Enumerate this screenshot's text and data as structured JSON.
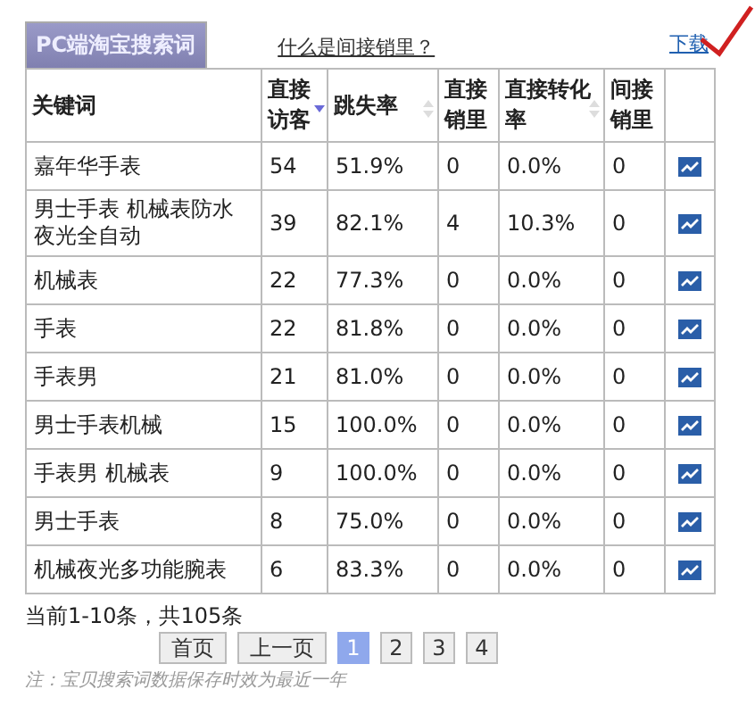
{
  "tab": {
    "label": "PC端淘宝搜索词",
    "selected": true
  },
  "help_link": "什么是间接销里？",
  "download_link": "下载",
  "table": {
    "columns": [
      {
        "label": "关键词"
      },
      {
        "label": "直接访客",
        "sorted": true
      },
      {
        "label": "跳失率",
        "sorted": false
      },
      {
        "label": "直接销里"
      },
      {
        "label": "直接转化率",
        "sorted": false
      },
      {
        "label": "间接销里"
      }
    ],
    "rows": [
      [
        "嘉年华手表",
        "54",
        "51.9%",
        "0",
        "0.0%",
        "0"
      ],
      [
        "男士手表 机械表防水夜光全自动",
        "39",
        "82.1%",
        "4",
        "10.3%",
        "0"
      ],
      [
        "机械表",
        "22",
        "77.3%",
        "0",
        "0.0%",
        "0"
      ],
      [
        "手表",
        "22",
        "81.8%",
        "0",
        "0.0%",
        "0"
      ],
      [
        "手表男",
        "21",
        "81.0%",
        "0",
        "0.0%",
        "0"
      ],
      [
        "男士手表机械",
        "15",
        "100.0%",
        "0",
        "0.0%",
        "0"
      ],
      [
        "手表男 机械表",
        "9",
        "100.0%",
        "0",
        "0.0%",
        "0"
      ],
      [
        "男士手表",
        "8",
        "75.0%",
        "0",
        "0.0%",
        "0"
      ],
      [
        "机械夜光多功能腕表",
        "6",
        "83.3%",
        "0",
        "0.0%",
        "0"
      ]
    ]
  },
  "summary": "当前1-10条，共105条",
  "pagination": [
    {
      "label": "首页",
      "kind": "nav",
      "selected": false
    },
    {
      "label": "上一页",
      "kind": "nav",
      "selected": false
    },
    {
      "label": "1",
      "kind": "page",
      "selected": true
    },
    {
      "label": "2",
      "kind": "page",
      "selected": false
    },
    {
      "label": "3",
      "kind": "page",
      "selected": false
    },
    {
      "label": "4",
      "kind": "page",
      "selected": false
    }
  ],
  "note": "注：宝贝搜索词数据保存时效为最近一年"
}
